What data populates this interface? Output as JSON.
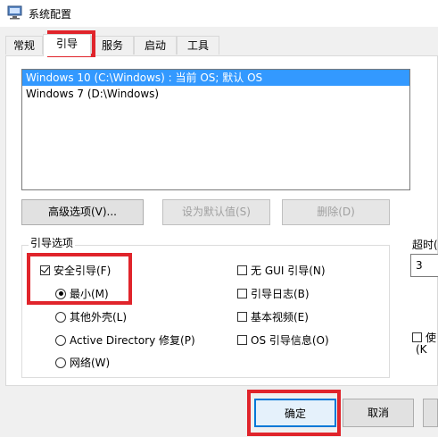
{
  "window": {
    "title": "系统配置"
  },
  "tabs": [
    {
      "label": "常规",
      "active": false
    },
    {
      "label": "引导",
      "active": true
    },
    {
      "label": "服务",
      "active": false
    },
    {
      "label": "启动",
      "active": false
    },
    {
      "label": "工具",
      "active": false
    }
  ],
  "os_list": [
    {
      "label": "Windows 10 (C:\\Windows) : 当前 OS; 默认 OS",
      "selected": true
    },
    {
      "label": "Windows 7 (D:\\Windows)",
      "selected": false
    }
  ],
  "buttons": {
    "advanced": "高级选项(V)...",
    "set_default": "设为默认值(S)",
    "delete": "删除(D)",
    "ok": "确定",
    "cancel": "取消"
  },
  "boot_options": {
    "group_label": "引导选项",
    "safe_boot": {
      "label": "安全引导(F)",
      "checked": true
    },
    "minimal": {
      "label": "最小(M)",
      "checked": true
    },
    "alternate_shell": {
      "label": "其他外壳(L)",
      "checked": false
    },
    "ad_repair": {
      "label": "Active Directory 修复(P)",
      "checked": false
    },
    "network": {
      "label": "网络(W)",
      "checked": false
    },
    "no_gui": {
      "label": "无 GUI 引导(N)",
      "checked": false
    },
    "boot_log": {
      "label": "引导日志(B)",
      "checked": false
    },
    "base_video": {
      "label": "基本视频(E)",
      "checked": false
    },
    "os_info": {
      "label": "OS 引导信息(O)",
      "checked": false
    }
  },
  "timeout": {
    "label": "超时(",
    "value": "3"
  },
  "make_permanent": {
    "label": "使",
    "hotkey": "(K"
  },
  "highlight_color": "#e0242b",
  "selection_color": "#3399ff"
}
